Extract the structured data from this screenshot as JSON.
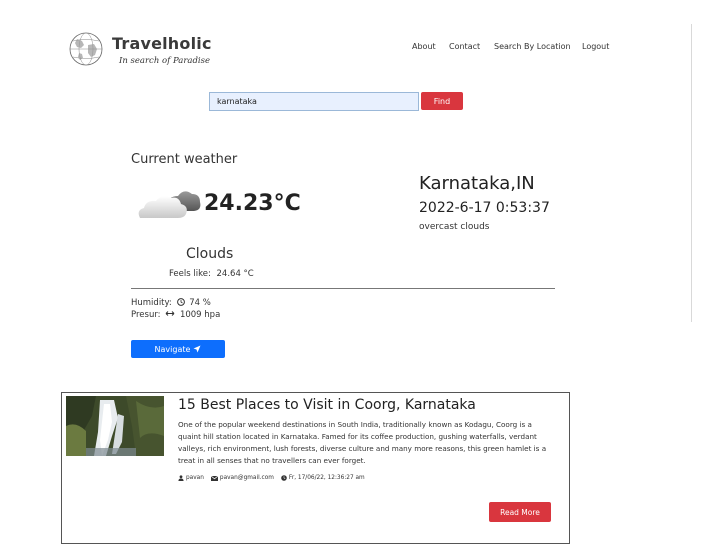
{
  "brand": {
    "name": "Travelholic",
    "tagline": "In search of Paradise"
  },
  "nav": {
    "items": [
      {
        "label": "About"
      },
      {
        "label": "Contact"
      },
      {
        "label": "Search By Location"
      },
      {
        "label": "Logout"
      }
    ]
  },
  "search": {
    "value": "karnataka",
    "button_label": "Find"
  },
  "weather": {
    "section_title": "Current weather",
    "icon": "cloud-icon",
    "temperature": "24.23°C",
    "condition": "Clouds",
    "feels_like_label": "Feels like:",
    "feels_like_value": "24.64 °C",
    "location": "Karnataka,IN",
    "datetime": "2022-6-17 0:53:37",
    "description": "overcast clouds",
    "humidity_label": "Humidity:",
    "humidity_value": "74 %",
    "pressure_label": "Presur:",
    "pressure_value": "1009 hpa",
    "navigate_label": "Navigate"
  },
  "article": {
    "title": "15 Best Places to Visit in Coorg, Karnataka",
    "excerpt": "One of the popular weekend destinations in South India, traditionally known as Kodagu, Coorg is a quaint hill station located in Karnataka. Famed for its coffee production, gushing waterfalls, verdant valleys, rich environment, lush forests, diverse culture and many more reasons, this green hamlet is a treat in all senses that no travellers can ever forget.",
    "author": "pavan",
    "email": "pavan@gmail.com",
    "date": "Fr, 17/06/22, 12:36:27 am",
    "read_more_label": "Read More"
  },
  "colors": {
    "accent_red": "#d9363e",
    "primary_blue": "#0d6efd",
    "input_bg": "#e8f0fe"
  }
}
